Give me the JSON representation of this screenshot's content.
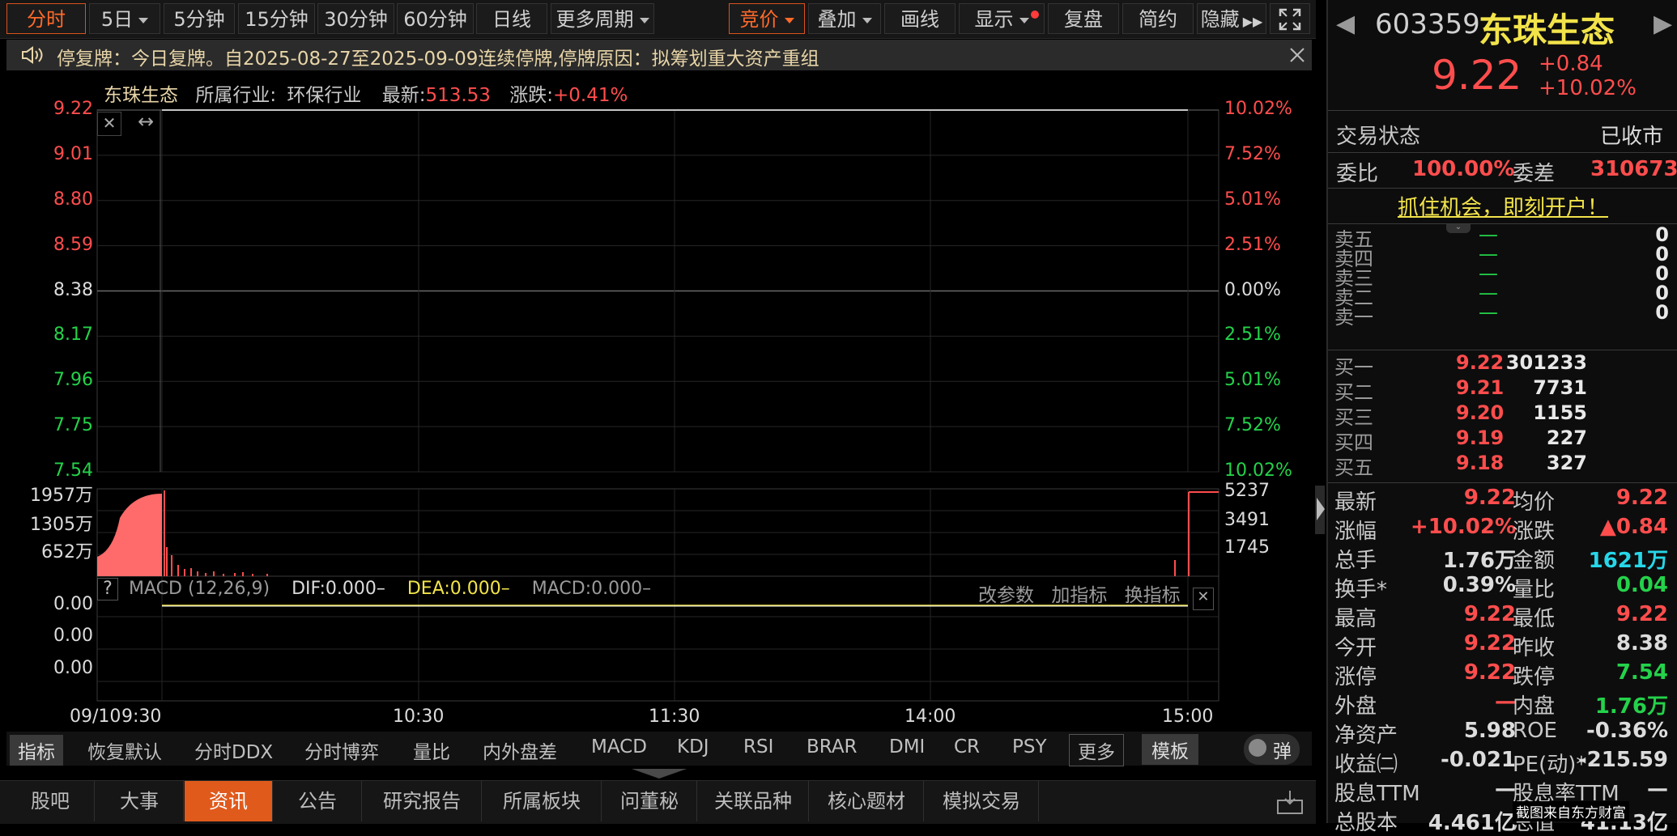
{
  "toolbar": {
    "buttons": [
      "分时",
      "5日",
      "5分钟",
      "15分钟",
      "30分钟",
      "60分钟",
      "日线",
      "更多周期",
      "竞价",
      "叠加",
      "画线",
      "显示",
      "复盘",
      "简约",
      "隐藏"
    ]
  },
  "notice": "停复牌：今日复牌。自2025-08-27至2025-09-09连续停牌,停牌原因：拟筹划重大资产重组",
  "chart_header": {
    "name": "东珠生态",
    "industry_label": "所属行业:",
    "industry": "环保行业",
    "latest_label": "最新:",
    "latest": "513.53",
    "change_label": "涨跌:",
    "change": "+0.41%"
  },
  "chart_data": [
    {
      "type": "line",
      "x_labels": [
        "09/10",
        "9:30",
        "10:30",
        "11:30",
        "14:00",
        "15:00"
      ],
      "price_ticks": [
        "9.22",
        "9.01",
        "8.80",
        "8.59",
        "8.38",
        "8.17",
        "7.96",
        "7.75",
        "7.54"
      ],
      "pct_ticks": [
        "10.02%",
        "7.52%",
        "5.01%",
        "2.51%",
        "0.00%",
        "2.51%",
        "5.01%",
        "7.52%",
        "10.02%"
      ],
      "series": [
        {
          "values": [
            9.22,
            9.22
          ]
        }
      ],
      "ylim": [
        7.54,
        9.22
      ]
    },
    {
      "type": "bar",
      "left_ticks": [
        "1957万",
        "1305万",
        "652万"
      ],
      "right_ticks": [
        "5237",
        "3491",
        "1745"
      ]
    },
    {
      "type": "line",
      "indicator": "MACD (12,26,9)",
      "dif": "DIF:0.000–",
      "dea": "DEA:0.000–",
      "macd": "MACD:0.000–",
      "ticks": [
        "0.00",
        "0.00",
        "0.00"
      ],
      "actions": [
        "改参数",
        "加指标",
        "换指标"
      ]
    }
  ],
  "indicators": [
    "指标",
    "恢复默认",
    "分时DDX",
    "分时博弈",
    "量比",
    "内外盘差",
    "MACD",
    "KDJ",
    "RSI",
    "BRAR",
    "DMI",
    "CR",
    "PSY",
    "更多",
    "模板",
    "弹"
  ],
  "tabs": [
    "股吧",
    "大事",
    "资讯",
    "公告",
    "研究报告",
    "所属板块",
    "问董秘",
    "关联品种",
    "核心题材",
    "模拟交易"
  ],
  "stock": {
    "code": "603359",
    "name": "东珠生态",
    "price": "9.22",
    "change": "+0.84",
    "pct": "+10.02%",
    "status_label": "交易状态",
    "status": "已收市",
    "weibi_label": "委比",
    "weibi": "100.00%",
    "weicha_label": "委差",
    "weicha": "310673",
    "promo": "抓住机会，即刻开户！"
  },
  "orderbook": {
    "sell": [
      {
        "label": "卖五",
        "price": "—",
        "vol": "0"
      },
      {
        "label": "卖四",
        "price": "—",
        "vol": "0"
      },
      {
        "label": "卖三",
        "price": "—",
        "vol": "0"
      },
      {
        "label": "卖二",
        "price": "—",
        "vol": "0"
      },
      {
        "label": "卖一",
        "price": "—",
        "vol": "0"
      }
    ],
    "buy": [
      {
        "label": "买一",
        "price": "9.22",
        "vol": "301233"
      },
      {
        "label": "买二",
        "price": "9.21",
        "vol": "7731"
      },
      {
        "label": "买三",
        "price": "9.20",
        "vol": "1155"
      },
      {
        "label": "买四",
        "price": "9.19",
        "vol": "227"
      },
      {
        "label": "买五",
        "price": "9.18",
        "vol": "327"
      }
    ]
  },
  "stats": [
    {
      "l1": "最新",
      "v1": "9.22",
      "c1": "red",
      "l2": "均价",
      "v2": "9.22",
      "c2": "red"
    },
    {
      "l1": "涨幅",
      "v1": "+10.02%",
      "c1": "red",
      "l2": "涨跌",
      "v2": "▲0.84",
      "c2": "red"
    },
    {
      "l1": "总手",
      "v1": "1.76万",
      "c1": "white",
      "l2": "金额",
      "v2": "1621万",
      "c2": "cyan"
    },
    {
      "l1": "换手*",
      "v1": "0.39%",
      "c1": "white",
      "l2": "量比",
      "v2": "0.04",
      "c2": "green"
    },
    {
      "l1": "最高",
      "v1": "9.22",
      "c1": "red",
      "l2": "最低",
      "v2": "9.22",
      "c2": "red"
    },
    {
      "l1": "今开",
      "v1": "9.22",
      "c1": "red",
      "l2": "昨收",
      "v2": "8.38",
      "c2": "white"
    },
    {
      "l1": "涨停",
      "v1": "9.22",
      "c1": "red",
      "l2": "跌停",
      "v2": "7.54",
      "c2": "green"
    },
    {
      "l1": "外盘",
      "v1": "—",
      "c1": "red",
      "l2": "内盘",
      "v2": "1.76万",
      "c2": "green"
    },
    {
      "l1": "净资产",
      "v1": "5.98",
      "c1": "white",
      "l2": "ROE",
      "v2": "-0.36%",
      "c2": "white"
    },
    {
      "l1": "收益㈡",
      "v1": "-0.021",
      "c1": "white",
      "l2": "PE(动)*",
      "v2": "-215.59",
      "c2": "white"
    },
    {
      "l1": "股息TTM",
      "v1": "—",
      "c1": "white",
      "l2": "股息率TTM",
      "v2": "—",
      "c2": "white"
    },
    {
      "l1": "总股本",
      "v1": "4.461亿",
      "c1": "white",
      "l2": "总值",
      "v2": "41.13亿",
      "c2": "white"
    }
  ],
  "watermark": "截图来自东方财富",
  "colors": {
    "up": "#ff4d4d",
    "down": "#24d24a",
    "accent": "#e05a1c"
  }
}
